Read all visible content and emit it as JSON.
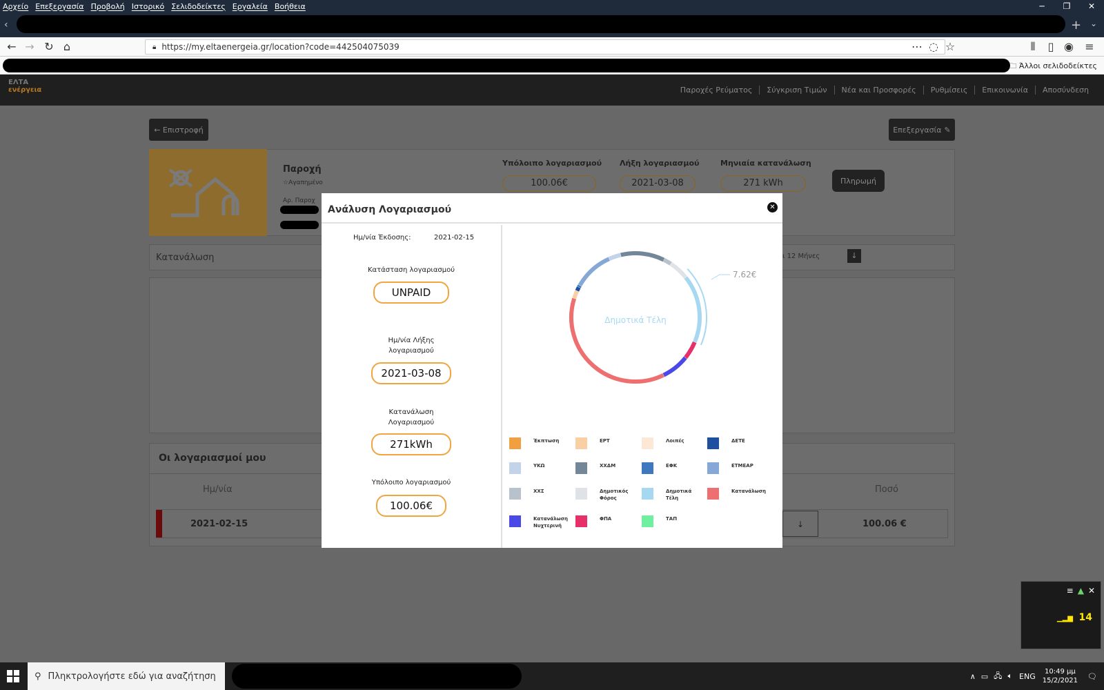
{
  "menubar": {
    "items": [
      "Αρχείο",
      "Επεξεργασία",
      "Προβολή",
      "Ιστορικό",
      "Σελιδοδείκτες",
      "Εργαλεία",
      "Βοήθεια"
    ]
  },
  "browser": {
    "url": "https://my.eltaenergeia.gr/location?code=442504075039",
    "bookmarks_other": "Άλλοι σελιδοδείκτες"
  },
  "site": {
    "logo_top": "ΕΛΤΑ",
    "logo_bottom": "ενέργεια",
    "nav": [
      "Παροχές Ρεύματος",
      "Σύγκριση Τιμών",
      "Νέα και Προσφορές",
      "Ρυθμίσεις",
      "Επικοινωνία",
      "Αποσύνδεση"
    ],
    "back_label": "← Επιστροφή",
    "edit_label": "Επεξεργασία",
    "supply_title": "Παροχή",
    "favorite_label": "☆Αγαπημένο",
    "supply_no_label": "Αρ. Παροχ",
    "balance_title": "Υπόλοιπο λογαριασμού",
    "balance_value": "100.06€",
    "expiry_title": "Λήξη λογαριασμού",
    "expiry_value": "2021-03-08",
    "monthly_title": "Μηνιαία κατανάλωση",
    "monthly_value": "271 kWh",
    "pay_label": "Πληρωμή",
    "consumption_title": "Κατανάλωση",
    "period_label": "ι 12 Μήνες",
    "bills_title": "Οι λογαριασμοί μου",
    "col_date": "Ημ/νία",
    "col_amount": "Ποσό",
    "row_date": "2021-02-15",
    "row_amount": "100.06 €"
  },
  "modal": {
    "title": "Ανάλυση Λογαριασμού",
    "issue_label": "Ημ/νία Έκδοσης:",
    "issue_value": "2021-02-15",
    "status_label": "Κατάσταση λογαριασμού",
    "status_value": "UNPAID",
    "due_label_1": "Ημ/νία Λήξης",
    "due_label_2": "λογαριασμού",
    "due_value": "2021-03-08",
    "cons_label_1": "Κατανάλωση",
    "cons_label_2": "Λογαριασμού",
    "cons_value": "271kWh",
    "balance_label": "Υπόλοιπο λογαριασμού",
    "balance_value": "100.06€",
    "donut_center": "Δημοτικά Τέλη",
    "donut_callout": "7.62€",
    "legend": [
      {
        "label": "Έκπτωση",
        "color": "#f0a040"
      },
      {
        "label": "ΕΡΤ",
        "color": "#f9cfa3"
      },
      {
        "label": "Λοιπές",
        "color": "#fde8d6"
      },
      {
        "label": "ΔΕΤΕ",
        "color": "#1f4fa0"
      },
      {
        "label": "ΥΚΩ",
        "color": "#c3d4ea"
      },
      {
        "label": "ΧΧΔΜ",
        "color": "#738799"
      },
      {
        "label": "ΕΦΚ",
        "color": "#3e78bf"
      },
      {
        "label": "ΕΤΜΕΑΡ",
        "color": "#86a8d6"
      },
      {
        "label": "ΧΧΣ",
        "color": "#b8c2cc"
      },
      {
        "label": "Δημοτικός Φόρος",
        "color": "#dfe3e8"
      },
      {
        "label": "Δημοτικά Τέλη",
        "color": "#a7d8f2"
      },
      {
        "label": "Κατανάλωση",
        "color": "#ee6f6f"
      },
      {
        "label": "Κατανάλωση Νυχτερινή",
        "color": "#4a48e6"
      },
      {
        "label": "ΦΠΑ",
        "color": "#e7306a"
      },
      {
        "label": "ΤΑΠ",
        "color": "#6ef0a0"
      }
    ],
    "segments": [
      {
        "label": "Δημοτικά Τέλη",
        "fraction": 0.17,
        "color": "#a7d8f2"
      },
      {
        "label": "ΦΠΑ",
        "fraction": 0.045,
        "color": "#e7306a"
      },
      {
        "label": "Κατανάλωση Νυχτερινή",
        "fraction": 0.07,
        "color": "#4a48e6"
      },
      {
        "label": "Κατανάλωση",
        "fraction": 0.37,
        "color": "#ee6f6f"
      },
      {
        "label": "ΕΡΤ",
        "fraction": 0.02,
        "color": "#f9cfa3"
      },
      {
        "label": "ΔΕΤΕ",
        "fraction": 0.01,
        "color": "#1f4fa0"
      },
      {
        "label": "ΕΦΚ",
        "fraction": 0.005,
        "color": "#3e78bf"
      },
      {
        "label": "ΕΤΜΕΑΡ",
        "fraction": 0.1,
        "color": "#86a8d6"
      },
      {
        "label": "ΥΚΩ",
        "fraction": 0.03,
        "color": "#c3d4ea"
      },
      {
        "label": "ΧΧΔΜ",
        "fraction": 0.11,
        "color": "#738799"
      },
      {
        "label": "ΧΧΣ",
        "fraction": 0.02,
        "color": "#b8c2cc"
      },
      {
        "label": "Δημοτικός Φόρος",
        "fraction": 0.05,
        "color": "#dfe3e8"
      }
    ]
  },
  "widget": {
    "value": "14"
  },
  "taskbar": {
    "search_placeholder": "Πληκτρολογήστε εδώ για αναζήτηση",
    "lang": "ENG",
    "time": "10:49 μμ",
    "date": "15/2/2021"
  }
}
